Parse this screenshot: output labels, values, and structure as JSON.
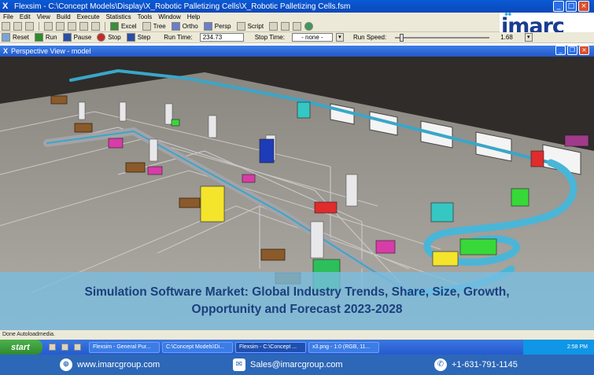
{
  "window": {
    "title": "Flexsim - C:\\Concept Models\\Display\\X_Robotic Palletizing Cells\\X_Robotic Palletizing Cells.fsm",
    "app_icon": "X"
  },
  "menu": [
    "File",
    "Edit",
    "View",
    "Build",
    "Execute",
    "Statistics",
    "Tools",
    "Window",
    "Help"
  ],
  "toolbar1": {
    "excel": "Excel",
    "tree": "Tree",
    "ortho": "Ortho",
    "persp": "Persp",
    "script": "Script"
  },
  "toolbar2": {
    "reset": "Reset",
    "run": "Run",
    "pause": "Pause",
    "stop": "Stop",
    "step": "Step",
    "run_time_label": "Run Time:",
    "run_time_value": "234.73",
    "stop_time_label": "Stop Time:",
    "stop_time_value": "- none -",
    "run_speed_label": "Run Speed:",
    "run_speed_value": "1.68"
  },
  "logo": {
    "text": "imarc"
  },
  "view": {
    "title": "Perspective View - model"
  },
  "banner": {
    "line1": "Simulation Software Market: Global Industry Trends, Share, Size, Growth,",
    "line2": "Opportunity and Forecast 2023-2028"
  },
  "status": {
    "text": "Done Autoloadmedia."
  },
  "taskbar": {
    "start": "start",
    "tasks": [
      "Flexsim - General Pur...",
      "C:\\Concept Models\\Di...",
      "Flexsim - C:\\Concept ...",
      "x3.png - 1:0 (RGB, 11..."
    ],
    "clock": "2:58 PM"
  },
  "footer": {
    "website": "www.imarcgroup.com",
    "email": "Sales@imarcgroup.com",
    "phone": "+1-631-791-1145"
  },
  "colors": {
    "banner_text": "#1b3f7c",
    "footer_bg": "#2d67b8",
    "logo": "#1a3c8f"
  }
}
